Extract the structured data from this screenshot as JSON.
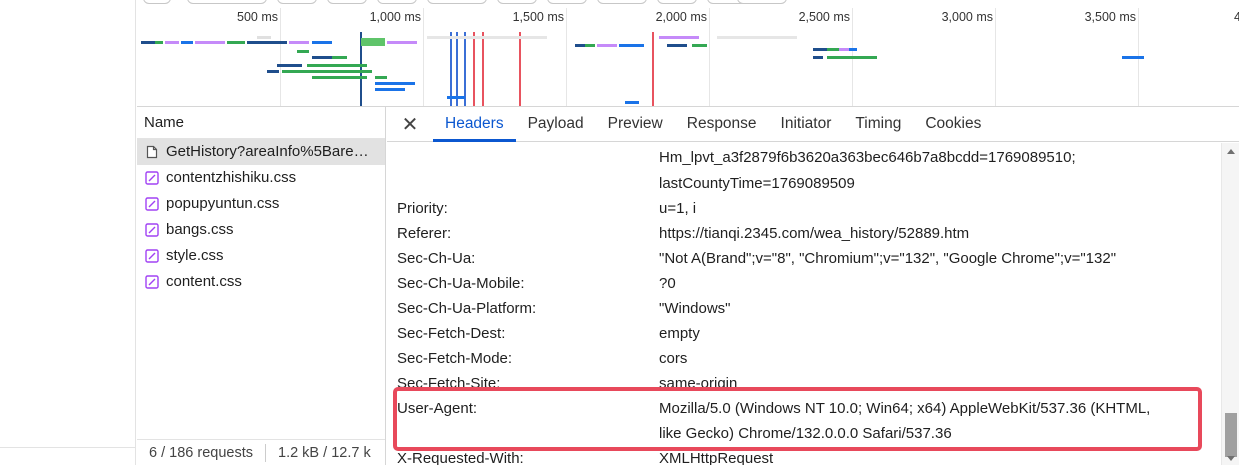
{
  "overview": {
    "ticks": [
      "500 ms",
      "1,000 ms",
      "1,500 ms",
      "2,000 ms",
      "2,500 ms",
      "3,000 ms",
      "3,500 ms",
      "4"
    ]
  },
  "request_list": {
    "header": "Name",
    "items": [
      {
        "name": "GetHistory?areaInfo%5Bare…",
        "type": "document",
        "selected": true
      },
      {
        "name": "contentzhishiku.css",
        "type": "stylesheet",
        "selected": false
      },
      {
        "name": "popupyuntun.css",
        "type": "stylesheet",
        "selected": false
      },
      {
        "name": "bangs.css",
        "type": "stylesheet",
        "selected": false
      },
      {
        "name": "style.css",
        "type": "stylesheet",
        "selected": false
      },
      {
        "name": "content.css",
        "type": "stylesheet",
        "selected": false
      }
    ],
    "footer": {
      "requests": "6 / 186 requests",
      "transferred": "1.2 kB / 12.7 k"
    }
  },
  "detail": {
    "close_icon": "close-icon",
    "tabs": [
      "Headers",
      "Payload",
      "Preview",
      "Response",
      "Initiator",
      "Timing",
      "Cookies"
    ],
    "active_tab": "Headers",
    "cookie_continuation": [
      "Hm_lpvt_a3f2879f6b3620a363bec646b7a8bcdd=1769089510;",
      "lastCountyTime=1769089509"
    ],
    "headers": [
      {
        "name": "Priority:",
        "value": "u=1, i"
      },
      {
        "name": "Referer:",
        "value": "https://tianqi.2345.com/wea_history/52889.htm"
      },
      {
        "name": "Sec-Ch-Ua:",
        "value": "\"Not A(Brand\";v=\"8\", \"Chromium\";v=\"132\", \"Google Chrome\";v=\"132\""
      },
      {
        "name": "Sec-Ch-Ua-Mobile:",
        "value": "?0"
      },
      {
        "name": "Sec-Ch-Ua-Platform:",
        "value": "\"Windows\""
      },
      {
        "name": "Sec-Fetch-Dest:",
        "value": "empty"
      },
      {
        "name": "Sec-Fetch-Mode:",
        "value": "cors"
      },
      {
        "name": "Sec-Fetch-Site:",
        "value": "same-origin"
      },
      {
        "name": "User-Agent:",
        "value_line1": "Mozilla/5.0 (Windows NT 10.0; Win64; x64) AppleWebKit/537.36 (KHTML,",
        "value_line2": "like Gecko) Chrome/132.0.0.0 Safari/537.36"
      },
      {
        "name": "X-Requested-With:",
        "value": "XMLHttpRequest"
      }
    ]
  },
  "colors": {
    "accent": "#0b57d0",
    "highlight": "#e8495b",
    "css_icon": "#a142f4",
    "bar_blue": "#1a73e8",
    "bar_green": "#34a853",
    "bar_purple": "#c58af9",
    "bar_navy": "#1f4e8c"
  }
}
